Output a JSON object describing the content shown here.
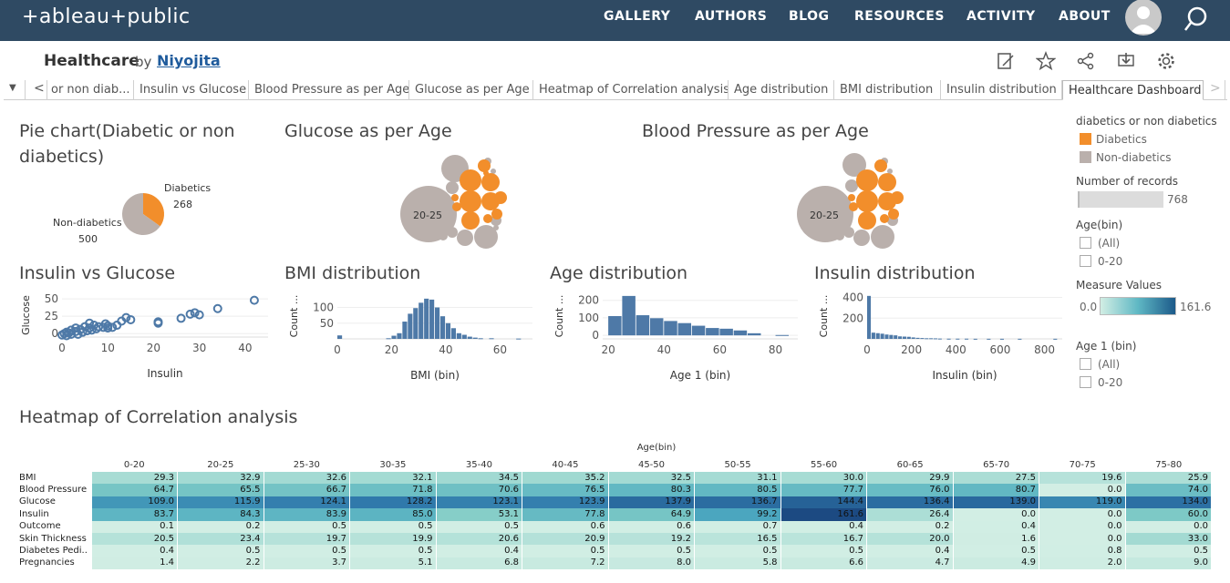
{
  "brand": {
    "logo": "+ableau+public"
  },
  "nav": [
    "GALLERY",
    "AUTHORS",
    "BLOG",
    "RESOURCES",
    "ACTIVITY",
    "ABOUT"
  ],
  "workbook": {
    "title": "Healthcare",
    "by": "by",
    "author": "Niyojita"
  },
  "tabs": [
    "or non diab...",
    "Insulin vs Glucose",
    "Blood Pressure as per Age",
    "Glucose as per Age",
    "Heatmap of Correlation analysis",
    "Age distribution",
    "BMI distribution",
    "Insulin distribution",
    "Healthcare Dashboard"
  ],
  "tab_controls": {
    "menu": "▼",
    "prev": "<",
    "next": ">"
  },
  "titles": {
    "pie_l1": "Pie chart(Diabetic or non",
    "pie_l2": "diabetics)",
    "glucose": "Glucose as per Age",
    "bp": "Blood Pressure as per Age",
    "insulin_glucose": "Insulin vs Glucose",
    "bmi": "BMI distribution",
    "age": "Age distribution",
    "insulin_dist": "Insulin distribution",
    "heatmap": "Heatmap of Correlation analysis"
  },
  "legend": {
    "color_title": "diabetics or non diabetics",
    "items": [
      {
        "label": "Diabetics",
        "color": "#f28e2b"
      },
      {
        "label": "Non-diabetics",
        "color": "#bab0ac"
      }
    ],
    "records_title": "Number of records",
    "records_value": "768",
    "agebin_title": "Age(bin)",
    "agebin_opts": [
      "(All)",
      "0-20"
    ],
    "measure_title": "Measure Values",
    "measure_min": "0.0",
    "measure_max": "161.6",
    "age1_title": "Age 1 (bin)",
    "age1_opts": [
      "(All)",
      "0-20"
    ]
  },
  "chart_data": [
    {
      "type": "pie",
      "title": "Pie chart(Diabetic or non diabetics)",
      "slices": [
        {
          "label": "Diabetics",
          "value": 268,
          "color": "#f28e2b"
        },
        {
          "label": "Non-diabetics",
          "value": 500,
          "color": "#bab0ac"
        }
      ]
    },
    {
      "type": "scatter",
      "title": "Insulin vs Glucose",
      "xlabel": "Insulin",
      "ylabel": "Glucose",
      "xticks": [
        0,
        10,
        20,
        30,
        40
      ],
      "yticks": [
        0,
        25,
        50
      ],
      "xlim": [
        0,
        45
      ],
      "ylim": [
        -5,
        58
      ],
      "points": [
        [
          0,
          -2
        ],
        [
          0.5,
          0
        ],
        [
          1,
          -3
        ],
        [
          1,
          2
        ],
        [
          1.5,
          1
        ],
        [
          2,
          5
        ],
        [
          2,
          -1
        ],
        [
          3,
          3
        ],
        [
          3,
          8
        ],
        [
          3.5,
          -1
        ],
        [
          4,
          6
        ],
        [
          4.5,
          2
        ],
        [
          5,
          10
        ],
        [
          5.5,
          4
        ],
        [
          6,
          8
        ],
        [
          6,
          15
        ],
        [
          6.5,
          5
        ],
        [
          7,
          12
        ],
        [
          7.5,
          7
        ],
        [
          8,
          10
        ],
        [
          9,
          9
        ],
        [
          9.5,
          14
        ],
        [
          10,
          11
        ],
        [
          10,
          8
        ],
        [
          11,
          9
        ],
        [
          12,
          12
        ],
        [
          13,
          18
        ],
        [
          14,
          23
        ],
        [
          15,
          20
        ],
        [
          21,
          15
        ],
        [
          21,
          17
        ],
        [
          26,
          22
        ],
        [
          28,
          28
        ],
        [
          29,
          30
        ],
        [
          30,
          27
        ],
        [
          34,
          36
        ],
        [
          42,
          48
        ]
      ]
    },
    {
      "type": "bar",
      "title": "BMI distribution",
      "xlabel": "BMI (bin)",
      "ylabel": "Count ...",
      "xticks": [
        0,
        20,
        40,
        60
      ],
      "yticks": [
        50,
        100
      ],
      "ylim": [
        0,
        145
      ],
      "bin_width": 2,
      "bins": [
        {
          "x": 0,
          "v": 11
        },
        {
          "x": 18,
          "v": 2
        },
        {
          "x": 20,
          "v": 10
        },
        {
          "x": 22,
          "v": 18
        },
        {
          "x": 24,
          "v": 55
        },
        {
          "x": 26,
          "v": 80
        },
        {
          "x": 28,
          "v": 98
        },
        {
          "x": 30,
          "v": 115
        },
        {
          "x": 32,
          "v": 128
        },
        {
          "x": 34,
          "v": 125
        },
        {
          "x": 36,
          "v": 100
        },
        {
          "x": 38,
          "v": 72
        },
        {
          "x": 40,
          "v": 50
        },
        {
          "x": 42,
          "v": 34
        },
        {
          "x": 44,
          "v": 18
        },
        {
          "x": 46,
          "v": 13
        },
        {
          "x": 48,
          "v": 7
        },
        {
          "x": 50,
          "v": 4
        },
        {
          "x": 52,
          "v": 2
        },
        {
          "x": 56,
          "v": 2
        },
        {
          "x": 66,
          "v": 1
        }
      ]
    },
    {
      "type": "bar",
      "title": "Age distribution",
      "xlabel": "Age 1 (bin)",
      "ylabel": "Count ...",
      "xticks": [
        20,
        40,
        60,
        80
      ],
      "yticks": [
        0,
        100,
        200
      ],
      "ylim": [
        -20,
        240
      ],
      "bin_width": 5,
      "bins": [
        {
          "x": 20,
          "v": 110
        },
        {
          "x": 25,
          "v": 225
        },
        {
          "x": 30,
          "v": 115
        },
        {
          "x": 35,
          "v": 98
        },
        {
          "x": 40,
          "v": 82
        },
        {
          "x": 45,
          "v": 70
        },
        {
          "x": 50,
          "v": 55
        },
        {
          "x": 55,
          "v": 42
        },
        {
          "x": 60,
          "v": 38
        },
        {
          "x": 65,
          "v": 28
        },
        {
          "x": 70,
          "v": 12
        },
        {
          "x": 80,
          "v": 2
        }
      ]
    },
    {
      "type": "bar",
      "title": "Insulin distribution",
      "xlabel": "Insulin (bin)",
      "ylabel": "Count ...",
      "xticks": [
        0,
        200,
        400,
        600,
        800
      ],
      "yticks": [
        200,
        400
      ],
      "ylim": [
        0,
        440
      ],
      "bin_width": 20,
      "bins": [
        {
          "x": 0,
          "v": 415
        },
        {
          "x": 20,
          "v": 60
        },
        {
          "x": 40,
          "v": 55
        },
        {
          "x": 60,
          "v": 50
        },
        {
          "x": 80,
          "v": 42
        },
        {
          "x": 100,
          "v": 38
        },
        {
          "x": 120,
          "v": 34
        },
        {
          "x": 140,
          "v": 24
        },
        {
          "x": 160,
          "v": 22
        },
        {
          "x": 180,
          "v": 20
        },
        {
          "x": 200,
          "v": 14
        },
        {
          "x": 220,
          "v": 10
        },
        {
          "x": 240,
          "v": 8
        },
        {
          "x": 260,
          "v": 6
        },
        {
          "x": 280,
          "v": 6
        },
        {
          "x": 300,
          "v": 5
        },
        {
          "x": 320,
          "v": 3
        },
        {
          "x": 360,
          "v": 2
        },
        {
          "x": 400,
          "v": 2
        },
        {
          "x": 440,
          "v": 2
        },
        {
          "x": 480,
          "v": 1
        },
        {
          "x": 540,
          "v": 1
        },
        {
          "x": 600,
          "v": 1
        },
        {
          "x": 680,
          "v": 1
        },
        {
          "x": 840,
          "v": 1
        }
      ]
    },
    {
      "type": "heatmap",
      "title": "Heatmap of Correlation analysis",
      "col_header": "Age(bin)",
      "min": 0.0,
      "max": 161.6,
      "cols": [
        "0-20",
        "20-25",
        "25-30",
        "30-35",
        "35-40",
        "40-45",
        "45-50",
        "50-55",
        "55-60",
        "60-65",
        "65-70",
        "70-75",
        "75-80"
      ],
      "rows": [
        "BMI",
        "Blood Pressure",
        "Glucose",
        "Insulin",
        "Outcome",
        "Skin Thickness",
        "Diabetes Pedi..",
        "Pregnancies"
      ],
      "values": [
        [
          29.3,
          32.9,
          32.6,
          32.1,
          34.5,
          35.2,
          32.5,
          31.1,
          30.0,
          29.9,
          27.5,
          19.6,
          25.9
        ],
        [
          64.7,
          65.5,
          66.7,
          71.8,
          70.6,
          76.5,
          80.3,
          80.5,
          77.7,
          76.0,
          80.7,
          0.0,
          74.0
        ],
        [
          109.0,
          115.9,
          124.1,
          128.2,
          123.1,
          123.9,
          137.9,
          136.7,
          144.4,
          136.4,
          139.0,
          119.0,
          134.0
        ],
        [
          83.7,
          84.3,
          83.9,
          85.0,
          53.1,
          77.8,
          64.9,
          99.2,
          161.6,
          26.4,
          0.0,
          0.0,
          60.0
        ],
        [
          0.1,
          0.2,
          0.5,
          0.5,
          0.5,
          0.6,
          0.6,
          0.7,
          0.4,
          0.2,
          0.4,
          0.0,
          0.0
        ],
        [
          20.5,
          23.4,
          19.7,
          19.9,
          20.6,
          20.9,
          19.2,
          16.5,
          16.7,
          20.0,
          1.6,
          0.0,
          33.0
        ],
        [
          0.4,
          0.5,
          0.5,
          0.5,
          0.4,
          0.5,
          0.5,
          0.5,
          0.5,
          0.4,
          0.5,
          0.8,
          0.5
        ],
        [
          1.4,
          2.2,
          3.7,
          5.1,
          6.8,
          7.2,
          8.0,
          5.8,
          6.6,
          4.7,
          4.9,
          2.0,
          9.0
        ]
      ]
    }
  ]
}
